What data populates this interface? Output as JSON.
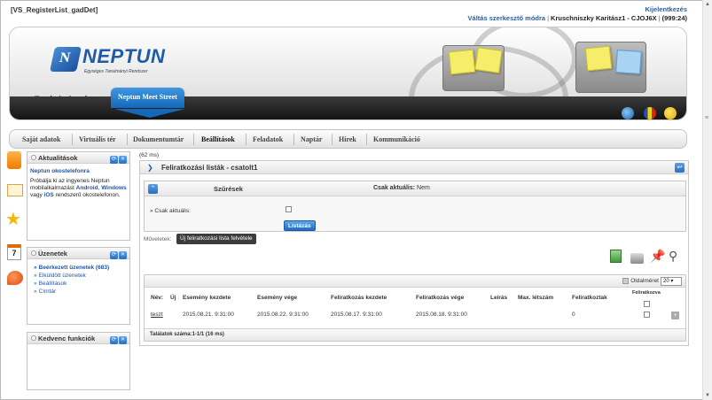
{
  "page_title": "[VS_RegisterList_gadDet]",
  "top_links": {
    "logout": "Kijelentkezés",
    "mode_switch": "Váltás szerkesztő módra",
    "separator": "|",
    "user": "Kruschniszky Karitász1 - CJOJ6X",
    "separator2": "|",
    "timer": "(999:24)"
  },
  "logo": {
    "mark": "N",
    "word": "NEPTUN",
    "subtitle": "Egységes Tanulmányi Rendszer"
  },
  "header_tabs": [
    {
      "label": "Tanulmányi rendszer"
    },
    {
      "label": "Neptun Meet Street"
    }
  ],
  "main_menu": [
    {
      "label": "Saját adatok"
    },
    {
      "label": "Virtuális tér"
    },
    {
      "label": "Dokumentumtár"
    },
    {
      "label": "Beállítások"
    },
    {
      "label": "Feladatok"
    },
    {
      "label": "Naptár"
    },
    {
      "label": "Hírek"
    },
    {
      "label": "Kommunikáció"
    }
  ],
  "portlets": {
    "news": {
      "title": "Aktualitások",
      "link_title": "Neptun okostelefonra",
      "text_a": "Próbálja ki az ingyenes Neptun mobilalkalmazást",
      "android": "Android",
      "comma": ",",
      "windows": "Windows",
      "text_b": "vagy",
      "ios": "iOS",
      "text_c": "rendszerű okostelefonon."
    },
    "messages": {
      "title": "Üzenetek",
      "items": [
        {
          "label": "Beérkezett üzenetek (683)"
        },
        {
          "label": "Elküldött üzenetek"
        },
        {
          "label": "Beállítások"
        },
        {
          "label": "Címtár"
        }
      ]
    },
    "favorites": {
      "title": "Kedvenc funkciók"
    }
  },
  "timing": "(62 ms)",
  "panel": {
    "title": "Feliratkozási listák - csatolt1",
    "filter": {
      "title": "Szűrések",
      "active_label": "Csak aktuális:",
      "active_value": "Nem",
      "field_label": "Csak aktuális:",
      "list_button": "Listázás"
    },
    "operations_label": "Műveletek:",
    "new_button": "Új feliratkozási lista felvétele",
    "grid": {
      "page_size_label": "Oldalméret",
      "page_size_value": "20",
      "columns": [
        {
          "label": "Név:"
        },
        {
          "label": "Új"
        },
        {
          "label": "Esemény kezdete"
        },
        {
          "label": "Esemény vége"
        },
        {
          "label": "Feliratkozás kezdete"
        },
        {
          "label": "Feliratkozás vége"
        },
        {
          "label": "Leírás"
        },
        {
          "label": "Max. létszám"
        },
        {
          "label": "Feliratkoztak"
        },
        {
          "label": "Feliratkozva"
        }
      ],
      "rows": [
        {
          "name": "teszt",
          "event_start": "2015.08.21. 9:31:00",
          "event_end": "2015.08.22. 9:31:00",
          "reg_start": "2015.08.17. 9:31:00",
          "reg_end": "2015.08.18. 9:31:00",
          "registered": "0"
        }
      ],
      "footer": "Találatok száma:1-1/1 (16 ms)"
    }
  },
  "colors": {
    "accent_blue": "#1f6cc2",
    "link_blue": "#1f56a8",
    "dark_button": "#3c3c3c"
  }
}
